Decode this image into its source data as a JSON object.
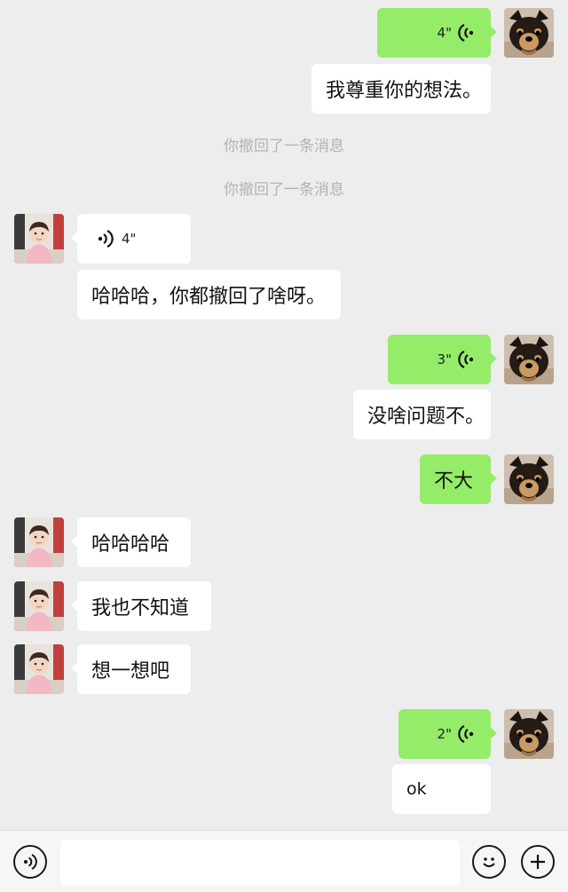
{
  "messages": [
    {
      "side": "right",
      "type": "voice",
      "duration": "4\""
    },
    {
      "side": "right",
      "type": "text",
      "text": "我尊重你的想法。"
    },
    {
      "type": "system",
      "text": "你撤回了一条消息"
    },
    {
      "type": "system",
      "text": "你撤回了一条消息"
    },
    {
      "side": "left",
      "type": "voice",
      "duration": "4\""
    },
    {
      "side": "left",
      "type": "text",
      "text": "哈哈哈，你都撤回了啥呀。"
    },
    {
      "side": "right",
      "type": "voice",
      "duration": "3\""
    },
    {
      "side": "right",
      "type": "text",
      "text": "没啥问题不。"
    },
    {
      "side": "right",
      "type": "text",
      "text": "不大"
    },
    {
      "side": "left",
      "type": "text",
      "text": "哈哈哈哈"
    },
    {
      "side": "left",
      "type": "text",
      "text": "我也不知道"
    },
    {
      "side": "left",
      "type": "text",
      "text": "想一想吧"
    },
    {
      "side": "right",
      "type": "voice",
      "duration": "2\""
    },
    {
      "side": "right",
      "type": "text",
      "text": "ok"
    }
  ],
  "avatars": {
    "self": "dog-avatar",
    "contact": "baby-avatar"
  },
  "input_bar": {
    "voice_button_icon": "voice-icon",
    "emoji_button_icon": "emoji-icon",
    "more_button_icon": "plus-icon",
    "input_value": ""
  },
  "colors": {
    "background": "#ededed",
    "outgoing_bubble": "#95ec69",
    "incoming_bubble": "#ffffff",
    "system_text": "#b3b3b3"
  }
}
